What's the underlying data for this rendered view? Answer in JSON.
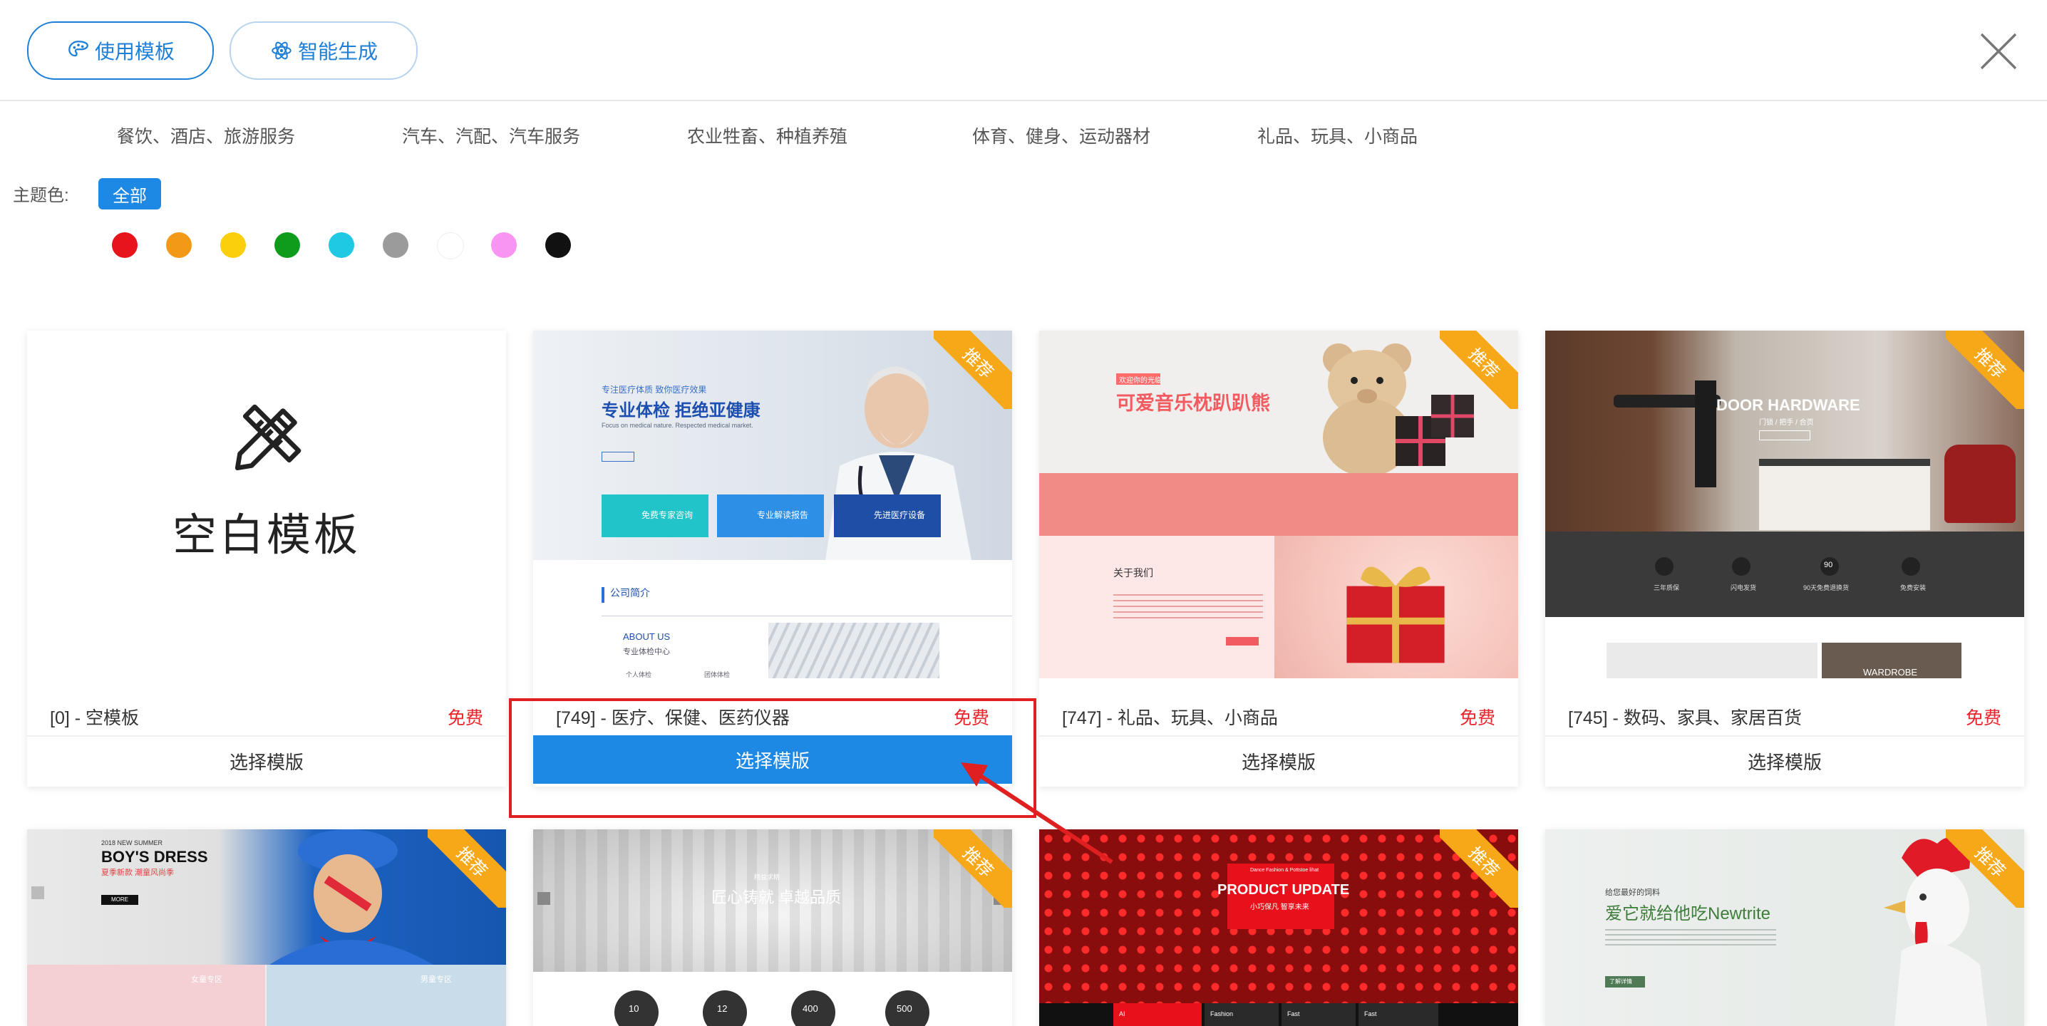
{
  "header": {
    "tab_template": "使用模板",
    "tab_ai": "智能生成"
  },
  "categories": [
    "餐饮、酒店、旅游服务",
    "汽车、汽配、汽车服务",
    "农业牲畜、种植养殖",
    "体育、健身、运动器材",
    "礼品、玩具、小商品"
  ],
  "theme": {
    "label": "主题色:",
    "all": "全部",
    "swatches": [
      "#e8141b",
      "#f29a17",
      "#fbcf0c",
      "#0f9b1c",
      "#1fc8e3",
      "#9b9b9b",
      "#ffffff",
      "#f895f2",
      "#111111"
    ]
  },
  "badge": "推荐",
  "select_label": "选择模版",
  "free_label": "免费",
  "cards": [
    {
      "name": "[0] - 空模板",
      "blank_title": "空白模板"
    },
    {
      "name": "[749] - 医疗、保健、医药仪器",
      "thumb": {
        "small_top": "专注医疗体质 致你医疗效果",
        "title": "专业体检  拒绝亚健康",
        "sub": "Focus on medical nature. Respected medical market.",
        "btn1": "免费专家咨询",
        "btn2": "专业解读报告",
        "btn3": "先进医疗设备",
        "section": "公司简介",
        "about": "ABOUT US",
        "about_sub": "专业体检中心",
        "small1": "个人体检",
        "small2": "团体体检"
      }
    },
    {
      "name": "[747] - 礼品、玩具、小商品",
      "thumb": {
        "tag": "欢迎你的光临",
        "title": "可爱音乐枕趴趴熊",
        "about": "关于我们"
      }
    },
    {
      "name": "[745] - 数码、家具、家居百货",
      "thumb": {
        "title": "DOOR  HARDWARE",
        "sub": "门锁 / 把手 / 合页",
        "i1": "三年质保",
        "i2": "闪电发货",
        "i3": "90天免费退换货",
        "i3num": "90",
        "i4": "免费安装",
        "wardrobe": "WARDROBE"
      }
    },
    {
      "thumb": {
        "sub": "2018 NEW SUMMER",
        "title": "BOY'S DRESS",
        "cn": "夏季新款  潮童风尚季",
        "btn": "MORE",
        "l1": "女童专区",
        "l2": "男童专区"
      }
    },
    {
      "thumb": {
        "sub": "精益求精",
        "title": "匠心铸就 卓越品质",
        "c1": "10",
        "c2": "12",
        "c3": "400",
        "c4": "500"
      }
    },
    {
      "thumb": {
        "sub": "Dance Fashion & Pottstoe lihat",
        "title": "PRODUCT UPDATE",
        "cn": "小巧保凡 智享未来",
        "n1": "AI",
        "n2": "Fashion",
        "n3": "Fast",
        "n4": "Fast"
      }
    },
    {
      "thumb": {
        "sub": "给您最好的饲料",
        "title": "爱它就给他吃Newtrite",
        "btn": "了解详情"
      }
    }
  ]
}
